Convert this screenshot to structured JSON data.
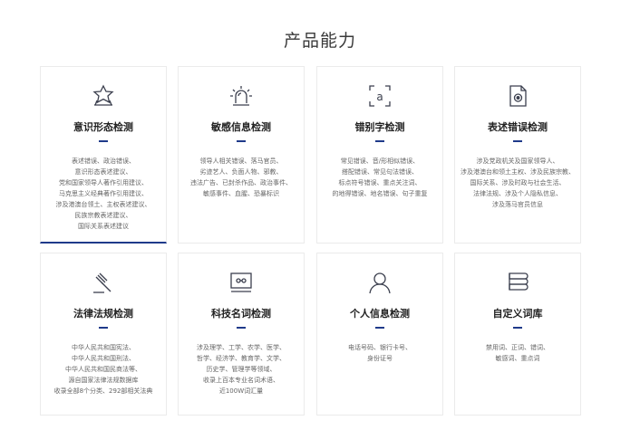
{
  "page": {
    "title": "产品能力"
  },
  "cards": [
    {
      "title": "意识形态检测",
      "icon": "star-badge-icon",
      "lines": [
        "表述错误、政治错误、",
        "意识形态表述建议、",
        "党和国家领导人著作引用建议、",
        "马克思主义经典著作引用建议、",
        "涉及港澳台领土、主权表述建议、",
        "民族宗教表述建议、",
        "国际关系表述建议"
      ]
    },
    {
      "title": "敏感信息检测",
      "icon": "alarm-light-icon",
      "lines": [
        "领导人相关错误、落马官员、",
        "劣迹艺人、负面人物、邪教、",
        "违法广告、已封杀作品、政治事件、",
        "敏感事件、血腥、恐暴标识"
      ]
    },
    {
      "title": "错别字检测",
      "icon": "text-scan-icon",
      "lines": [
        "常见错误、音/形相似错误、",
        "搭配错误、常见句法错误、",
        "标点符号错误、重点关注词、",
        "的地得错误、地名错误、句子重复"
      ]
    },
    {
      "title": "表述错误检测",
      "icon": "document-record-icon",
      "lines": [
        "涉及党政机关及国家领导人、",
        "涉及港澳台和领土主权、涉及民族宗教、",
        "国际关系、涉及时政与社会生活、",
        "法律法规、涉及个人隐私信息、",
        "涉及落马官员信息"
      ]
    },
    {
      "title": "法律法规检测",
      "icon": "gavel-icon",
      "lines": [
        "中华人民共和国宪法、",
        "中华人民共和国刑法、",
        "中华人民共和国民商法等、",
        "源自国家法律法规数据库",
        "收录全部8个分类、292部相关法典"
      ]
    },
    {
      "title": "科技名词检测",
      "icon": "monitor-code-icon",
      "lines": [
        "涉及理学、工学、农学、医学、",
        "哲学、经济学、教育学、文学、",
        "历史学、管理学等领域、",
        "收录上百本专业名词术语、",
        "近100W词汇量"
      ]
    },
    {
      "title": "个人信息检测",
      "icon": "person-icon",
      "lines": [
        "电话号码、银行卡号、",
        "身份证号"
      ]
    },
    {
      "title": "自定义词库",
      "icon": "books-stack-icon",
      "lines": [
        "禁用词、正词、错词、",
        "敏感词、重点词"
      ]
    }
  ]
}
